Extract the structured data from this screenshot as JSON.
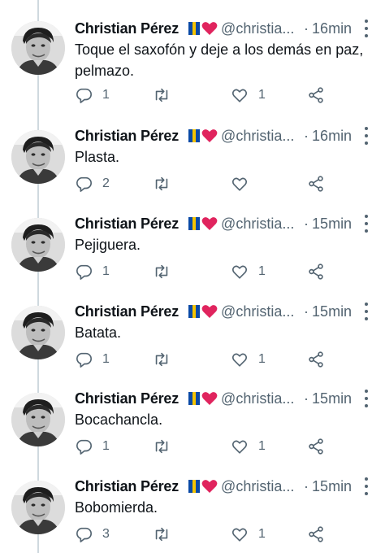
{
  "author": {
    "name": "Christian Pérez",
    "handle": "@christia...",
    "separator": "·"
  },
  "colors": {
    "text": "#0f1419",
    "secondary": "#536471",
    "heart": "#e0245e",
    "flag": [
      "#0a4aa6",
      "#f5c400",
      "#0a4aa6"
    ]
  },
  "icons": [
    "reply-icon",
    "retweet-icon",
    "like-icon",
    "share-icon",
    "more-icon",
    "canary-flag-icon",
    "red-heart-icon"
  ],
  "tweets": [
    {
      "time": "16min",
      "text": "Toque el saxofón y deje a los demás en paz, pelmazo.",
      "replies": "1",
      "retweets": "",
      "likes": "1"
    },
    {
      "time": "16min",
      "text": "Plasta.",
      "replies": "2",
      "retweets": "",
      "likes": ""
    },
    {
      "time": "15min",
      "text": "Pejiguera.",
      "replies": "1",
      "retweets": "",
      "likes": "1"
    },
    {
      "time": "15min",
      "text": "Batata.",
      "replies": "1",
      "retweets": "",
      "likes": "1"
    },
    {
      "time": "15min",
      "text": "Bocachancla.",
      "replies": "1",
      "retweets": "",
      "likes": "1"
    },
    {
      "time": "15min",
      "text": "Bobomierda.",
      "replies": "3",
      "retweets": "",
      "likes": "1"
    }
  ]
}
